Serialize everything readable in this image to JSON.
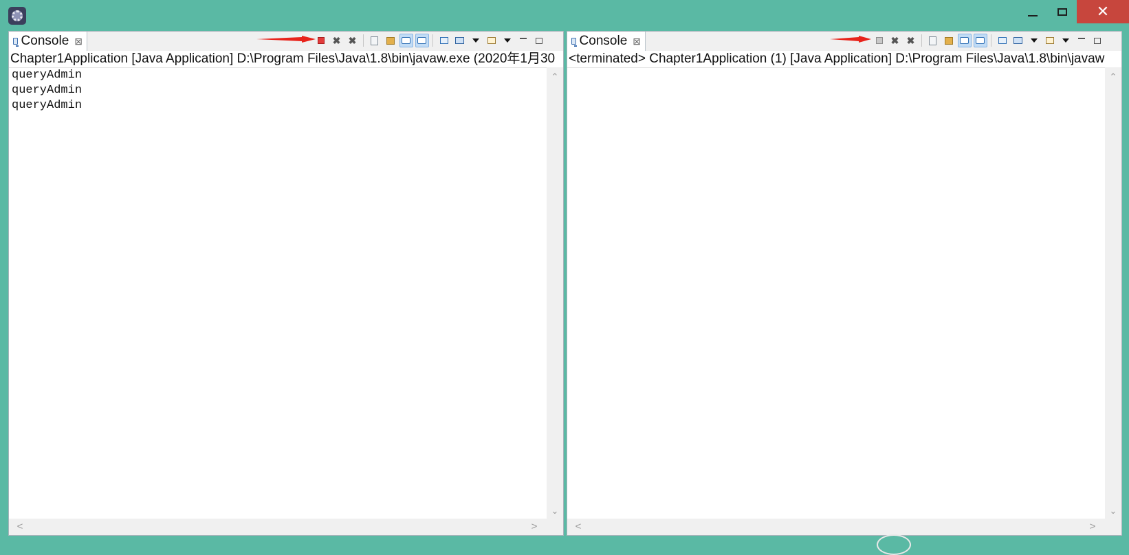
{
  "window": {
    "minimize_icon": "window-minimize-icon",
    "maximize_icon": "window-maximize-icon",
    "close_icon": "window-close-icon",
    "close_glyph": "✕"
  },
  "left": {
    "tab_label": "Console",
    "tab_close": "⊠",
    "status": "Chapter1Application [Java Application] D:\\Program Files\\Java\\1.8\\bin\\javaw.exe (2020年1月30",
    "output_lines": [
      "queryAdmin",
      "queryAdmin",
      "queryAdmin"
    ],
    "terminate_enabled": true
  },
  "right": {
    "tab_label": "Console",
    "tab_close": "⊠",
    "status": "<terminated> Chapter1Application (1) [Java Application] D:\\Program Files\\Java\\1.8\\bin\\javaw",
    "output_lines": [],
    "terminate_enabled": false
  },
  "toolbar": {
    "remove_launch": "✖",
    "remove_all": "✖",
    "up_glyph": "⌃",
    "down_glyph": "⌄",
    "left_glyph": "<",
    "right_glyph": ">"
  },
  "colors": {
    "background": "#5ab9a4",
    "annotation_arrow": "#e8231b",
    "terminate_active": "#e23b3b"
  }
}
